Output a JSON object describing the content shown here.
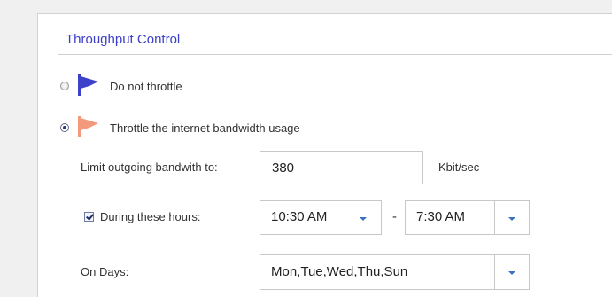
{
  "panel": {
    "title": "Throughput Control"
  },
  "options": {
    "no_throttle": {
      "label": "Do not throttle",
      "selected": false,
      "flag_color": "#3d40c8",
      "icon": "flag-icon"
    },
    "throttle": {
      "label": "Throttle the internet bandwidth usage",
      "selected": true,
      "flag_color": "#f39a7c",
      "icon": "flag-icon"
    }
  },
  "limit": {
    "label": "Limit outgoing bandwith to:",
    "value": "380",
    "unit": "Kbit/sec"
  },
  "hours": {
    "checkbox_label": "During these hours:",
    "checked": true,
    "start": "10:30 AM",
    "separator": "-",
    "end": "7:30 AM"
  },
  "days": {
    "label": "On Days:",
    "value": "Mon,Tue,Wed,Thu,Sun"
  },
  "colors": {
    "accent": "#3d40c8",
    "caret": "#3a70c2"
  }
}
